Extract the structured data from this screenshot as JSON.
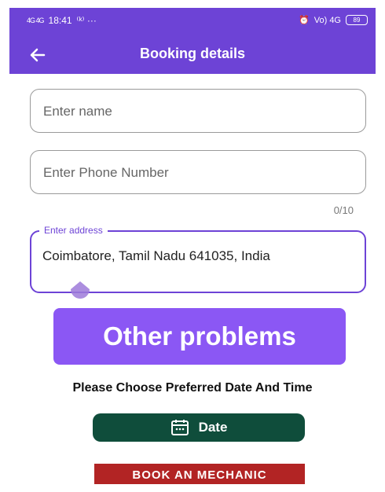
{
  "status_bar": {
    "signal": "4G 4G",
    "time": "18:41",
    "extra": "⁽ᵏ⁾ ···",
    "network_right": "Vo) 4G",
    "battery": "89"
  },
  "app_bar": {
    "title": "Booking details"
  },
  "form": {
    "name_placeholder": "Enter name",
    "phone_placeholder": "Enter Phone Number",
    "phone_counter": "0/10",
    "address_label": "Enter address",
    "address_value": "Coimbatore, Tamil Nadu 641035, India"
  },
  "problem_button": {
    "label": "Other problems"
  },
  "date_section": {
    "prompt": "Please Choose Preferred Date And Time",
    "date_button_label": "Date"
  },
  "book_button": {
    "label": "BOOK AN MECHANIC"
  },
  "colors": {
    "primary": "#6d43d6",
    "problem_button": "#8b57f4",
    "date_button": "#0f4d3b",
    "book_button": "#b22424"
  }
}
